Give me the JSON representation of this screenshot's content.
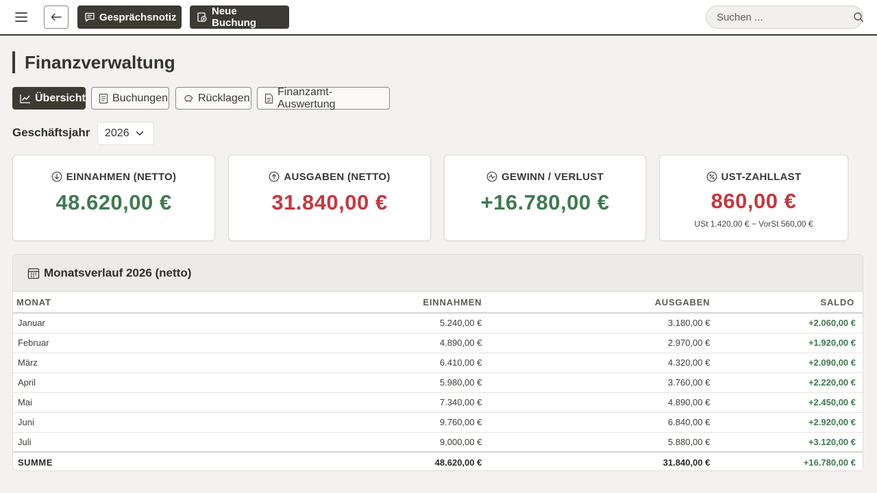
{
  "header": {
    "menu_icon": "hamburger-menu-icon",
    "back_icon": "arrow-left-icon",
    "note_button": "Gesprächsnotiz",
    "booking_button": "Neue Buchung",
    "search_placeholder": "Suchen ..."
  },
  "page": {
    "title": "Finanzverwaltung"
  },
  "tabs": [
    {
      "label": "Übersicht",
      "icon": "trend-chart-icon",
      "active": true
    },
    {
      "label": "Buchungen",
      "icon": "ledger-icon",
      "active": false
    },
    {
      "label": "Rücklagen",
      "icon": "piggy-bank-icon",
      "active": false
    },
    {
      "label": "Finanzamt-Auswertung",
      "icon": "document-icon",
      "active": false
    }
  ],
  "fiscal_year": {
    "label": "Geschäftsjahr",
    "value": "2026"
  },
  "kpis": [
    {
      "label": "EINNAHMEN (NETTO)",
      "value": "48.620,00 €",
      "icon": "arrow-down-circle-icon",
      "color": "#3f7a4e"
    },
    {
      "label": "AUSGABEN (NETTO)",
      "value": "31.840,00 €",
      "icon": "arrow-up-circle-icon",
      "color": "#c8363d"
    },
    {
      "label": "GEWINN / VERLUST",
      "value": "+16.780,00 €",
      "icon": "pulse-circle-icon",
      "color": "#3f7a4e"
    },
    {
      "label": "UST-ZAHLLAST",
      "value": "860,00 €",
      "sub": "USt 1.420,00 € − VorSt 560,00 €",
      "icon": "percent-circle-icon",
      "color": "#c8363d"
    }
  ],
  "monthly": {
    "title": "Monatsverlauf 2026 (netto)",
    "columns": [
      "MONAT",
      "EINNAHMEN",
      "AUSGABEN",
      "SALDO"
    ],
    "rows": [
      {
        "month": "Januar",
        "income": "5.240,00 €",
        "expenses": "3.180,00 €",
        "saldo": "+2.060,00 €"
      },
      {
        "month": "Februar",
        "income": "4.890,00 €",
        "expenses": "2.970,00 €",
        "saldo": "+1.920,00 €"
      },
      {
        "month": "März",
        "income": "6.410,00 €",
        "expenses": "4.320,00 €",
        "saldo": "+2.090,00 €"
      },
      {
        "month": "April",
        "income": "5.980,00 €",
        "expenses": "3.760,00 €",
        "saldo": "+2.220,00 €"
      },
      {
        "month": "Mai",
        "income": "7.340,00 €",
        "expenses": "4.890,00 €",
        "saldo": "+2.450,00 €"
      },
      {
        "month": "Juni",
        "income": "9.760,00 €",
        "expenses": "6.840,00 €",
        "saldo": "+2.920,00 €"
      },
      {
        "month": "Juli",
        "income": "9.000,00 €",
        "expenses": "5.880,00 €",
        "saldo": "+3.120,00 €"
      }
    ],
    "total": {
      "month": "SUMME",
      "income": "48.620,00 €",
      "expenses": "31.840,00 €",
      "saldo": "+16.780,00 €"
    }
  }
}
